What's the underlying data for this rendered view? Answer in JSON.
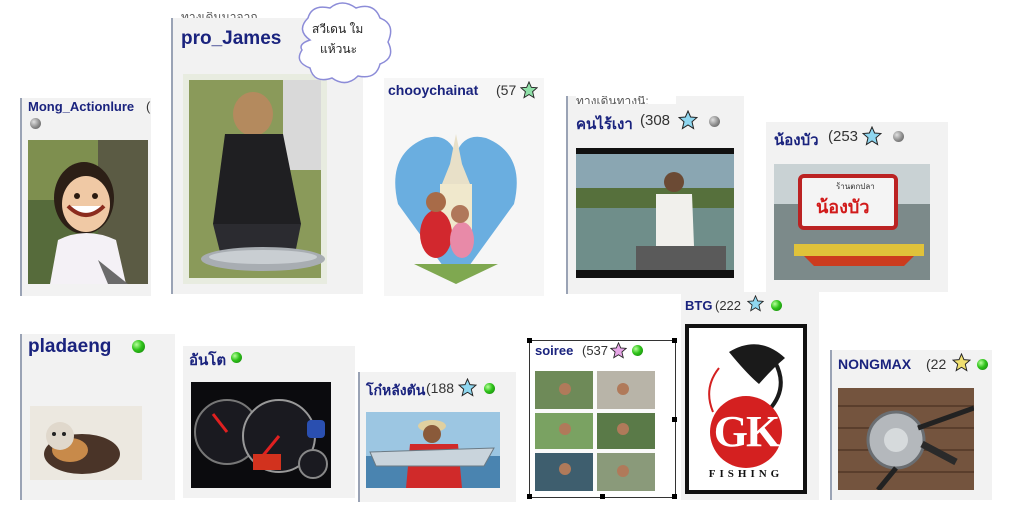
{
  "cards": [
    {
      "id": "mong",
      "name": "Mong_Actionlure",
      "suffix": " (",
      "status": "gray"
    },
    {
      "id": "james",
      "partial_top": "ทางเดินนาจาก",
      "name": "pro_James"
    },
    {
      "id": "chooy",
      "name": "chooychainat",
      "count": "(57",
      "star_color": "#8fe0a8",
      "status": null
    },
    {
      "id": "konrai",
      "partial_top": "ทางเดินทางนี้:",
      "name": "คนไร้เงา",
      "count": "(308",
      "star_color": "#8fd7f0",
      "status": "gray"
    },
    {
      "id": "nongbua",
      "name": "น้องบัว",
      "count": "(253",
      "star_color": "#8fd7f0",
      "status": "gray"
    },
    {
      "id": "pladaeng",
      "name": "pladaeng",
      "status": "green"
    },
    {
      "id": "anto",
      "name": "อันโต",
      "status": "green"
    },
    {
      "id": "kolang",
      "name": "โก๋หลังตัน",
      "count": "(188",
      "star_color": "#8fd7f0",
      "status": "green"
    },
    {
      "id": "soiree",
      "name": "soiree",
      "count": "(537",
      "star_color": "#e6a6e6",
      "status": "green"
    },
    {
      "id": "btg",
      "name": "BTG",
      "count": "(222",
      "star_color": "#8fd7f0",
      "status": "green"
    },
    {
      "id": "nongmax",
      "name": "NONGMAX",
      "count": "(22",
      "star_color": "#f0e070",
      "status": "green"
    }
  ],
  "bubble_text": [
    "สวีเดน ใม",
    "แห้วนะ"
  ],
  "logos": {
    "nongbua_sign": "น้องบัว",
    "nongbua_sign_small": "ร้านตกปลา",
    "gk_letters": "GK",
    "gk_word": "FISHING"
  }
}
